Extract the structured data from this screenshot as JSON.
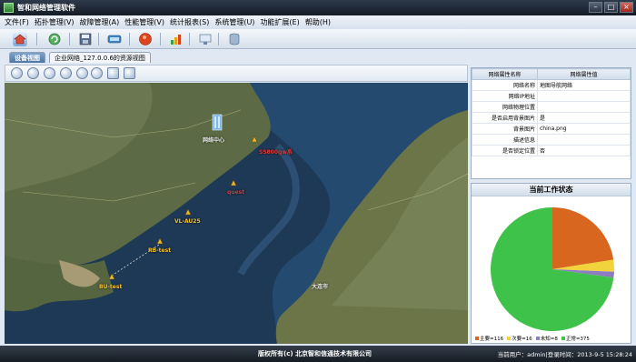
{
  "window": {
    "title": "智和网络管理软件"
  },
  "menu": [
    "文件(F)",
    "拓扑管理(V)",
    "故障管理(A)",
    "性能管理(V)",
    "统计报表(S)",
    "系统管理(U)",
    "功能扩展(E)",
    "帮助(H)"
  ],
  "tabs": [
    {
      "label": "设备视图",
      "active": true
    },
    {
      "label": "企业网络_127.0.0.6的资源视图",
      "active": false
    }
  ],
  "map": {
    "labels": {
      "center": "网络中心",
      "s5800": "S5800gw系",
      "quest": "quest",
      "vl_au25": "VL-AU25",
      "rb_test": "RB-test",
      "bu_test": "BU-test",
      "city": "大连市"
    }
  },
  "properties": {
    "headers": {
      "name": "网络属性名称",
      "value": "网络属性值"
    },
    "rows": [
      {
        "name": "网络名称",
        "value": "地图导航网络"
      },
      {
        "name": "网络IP地址",
        "value": ""
      },
      {
        "name": "网络物理位置",
        "value": ""
      },
      {
        "name": "是否启用背景图片",
        "value": "是"
      },
      {
        "name": "背景图片",
        "value": "china.png"
      },
      {
        "name": "描述信息",
        "value": ""
      },
      {
        "name": "是否锁定位置",
        "value": "否"
      }
    ]
  },
  "status_panel": {
    "title": "当前工作状态",
    "chart_data": {
      "type": "pie",
      "slices": [
        {
          "label": "主要",
          "value": 116,
          "color": "#d9661f"
        },
        {
          "label": "次要",
          "value": 16,
          "color": "#f1d43b"
        },
        {
          "label": "未知",
          "value": 8,
          "color": "#8e7cc3"
        },
        {
          "label": "正常",
          "value": 375,
          "color": "#3fc24a"
        }
      ]
    },
    "legend_text": [
      "主要=116",
      "次要=16",
      "未知=8",
      "正常=375"
    ]
  },
  "footer": {
    "copyright": "版权所有(c)  北京智和信通技术有限公司",
    "user_info": "当前用户：admin|登录时间：2013-9-5  15:28:24"
  },
  "colors": {
    "titlebar": "#1a2230",
    "accent": "#4d76a4"
  }
}
